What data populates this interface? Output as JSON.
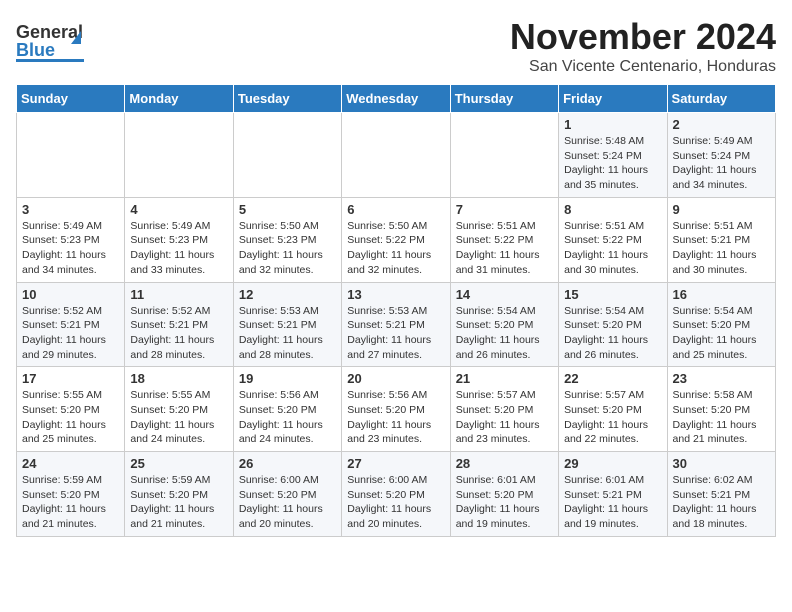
{
  "header": {
    "logo_general": "General",
    "logo_blue": "Blue",
    "title": "November 2024",
    "subtitle": "San Vicente Centenario, Honduras"
  },
  "weekdays": [
    "Sunday",
    "Monday",
    "Tuesday",
    "Wednesday",
    "Thursday",
    "Friday",
    "Saturday"
  ],
  "weeks": [
    [
      {
        "day": "",
        "info": ""
      },
      {
        "day": "",
        "info": ""
      },
      {
        "day": "",
        "info": ""
      },
      {
        "day": "",
        "info": ""
      },
      {
        "day": "",
        "info": ""
      },
      {
        "day": "1",
        "info": "Sunrise: 5:48 AM\nSunset: 5:24 PM\nDaylight: 11 hours\nand 35 minutes."
      },
      {
        "day": "2",
        "info": "Sunrise: 5:49 AM\nSunset: 5:24 PM\nDaylight: 11 hours\nand 34 minutes."
      }
    ],
    [
      {
        "day": "3",
        "info": "Sunrise: 5:49 AM\nSunset: 5:23 PM\nDaylight: 11 hours\nand 34 minutes."
      },
      {
        "day": "4",
        "info": "Sunrise: 5:49 AM\nSunset: 5:23 PM\nDaylight: 11 hours\nand 33 minutes."
      },
      {
        "day": "5",
        "info": "Sunrise: 5:50 AM\nSunset: 5:23 PM\nDaylight: 11 hours\nand 32 minutes."
      },
      {
        "day": "6",
        "info": "Sunrise: 5:50 AM\nSunset: 5:22 PM\nDaylight: 11 hours\nand 32 minutes."
      },
      {
        "day": "7",
        "info": "Sunrise: 5:51 AM\nSunset: 5:22 PM\nDaylight: 11 hours\nand 31 minutes."
      },
      {
        "day": "8",
        "info": "Sunrise: 5:51 AM\nSunset: 5:22 PM\nDaylight: 11 hours\nand 30 minutes."
      },
      {
        "day": "9",
        "info": "Sunrise: 5:51 AM\nSunset: 5:21 PM\nDaylight: 11 hours\nand 30 minutes."
      }
    ],
    [
      {
        "day": "10",
        "info": "Sunrise: 5:52 AM\nSunset: 5:21 PM\nDaylight: 11 hours\nand 29 minutes."
      },
      {
        "day": "11",
        "info": "Sunrise: 5:52 AM\nSunset: 5:21 PM\nDaylight: 11 hours\nand 28 minutes."
      },
      {
        "day": "12",
        "info": "Sunrise: 5:53 AM\nSunset: 5:21 PM\nDaylight: 11 hours\nand 28 minutes."
      },
      {
        "day": "13",
        "info": "Sunrise: 5:53 AM\nSunset: 5:21 PM\nDaylight: 11 hours\nand 27 minutes."
      },
      {
        "day": "14",
        "info": "Sunrise: 5:54 AM\nSunset: 5:20 PM\nDaylight: 11 hours\nand 26 minutes."
      },
      {
        "day": "15",
        "info": "Sunrise: 5:54 AM\nSunset: 5:20 PM\nDaylight: 11 hours\nand 26 minutes."
      },
      {
        "day": "16",
        "info": "Sunrise: 5:54 AM\nSunset: 5:20 PM\nDaylight: 11 hours\nand 25 minutes."
      }
    ],
    [
      {
        "day": "17",
        "info": "Sunrise: 5:55 AM\nSunset: 5:20 PM\nDaylight: 11 hours\nand 25 minutes."
      },
      {
        "day": "18",
        "info": "Sunrise: 5:55 AM\nSunset: 5:20 PM\nDaylight: 11 hours\nand 24 minutes."
      },
      {
        "day": "19",
        "info": "Sunrise: 5:56 AM\nSunset: 5:20 PM\nDaylight: 11 hours\nand 24 minutes."
      },
      {
        "day": "20",
        "info": "Sunrise: 5:56 AM\nSunset: 5:20 PM\nDaylight: 11 hours\nand 23 minutes."
      },
      {
        "day": "21",
        "info": "Sunrise: 5:57 AM\nSunset: 5:20 PM\nDaylight: 11 hours\nand 23 minutes."
      },
      {
        "day": "22",
        "info": "Sunrise: 5:57 AM\nSunset: 5:20 PM\nDaylight: 11 hours\nand 22 minutes."
      },
      {
        "day": "23",
        "info": "Sunrise: 5:58 AM\nSunset: 5:20 PM\nDaylight: 11 hours\nand 21 minutes."
      }
    ],
    [
      {
        "day": "24",
        "info": "Sunrise: 5:59 AM\nSunset: 5:20 PM\nDaylight: 11 hours\nand 21 minutes."
      },
      {
        "day": "25",
        "info": "Sunrise: 5:59 AM\nSunset: 5:20 PM\nDaylight: 11 hours\nand 21 minutes."
      },
      {
        "day": "26",
        "info": "Sunrise: 6:00 AM\nSunset: 5:20 PM\nDaylight: 11 hours\nand 20 minutes."
      },
      {
        "day": "27",
        "info": "Sunrise: 6:00 AM\nSunset: 5:20 PM\nDaylight: 11 hours\nand 20 minutes."
      },
      {
        "day": "28",
        "info": "Sunrise: 6:01 AM\nSunset: 5:20 PM\nDaylight: 11 hours\nand 19 minutes."
      },
      {
        "day": "29",
        "info": "Sunrise: 6:01 AM\nSunset: 5:21 PM\nDaylight: 11 hours\nand 19 minutes."
      },
      {
        "day": "30",
        "info": "Sunrise: 6:02 AM\nSunset: 5:21 PM\nDaylight: 11 hours\nand 18 minutes."
      }
    ]
  ]
}
